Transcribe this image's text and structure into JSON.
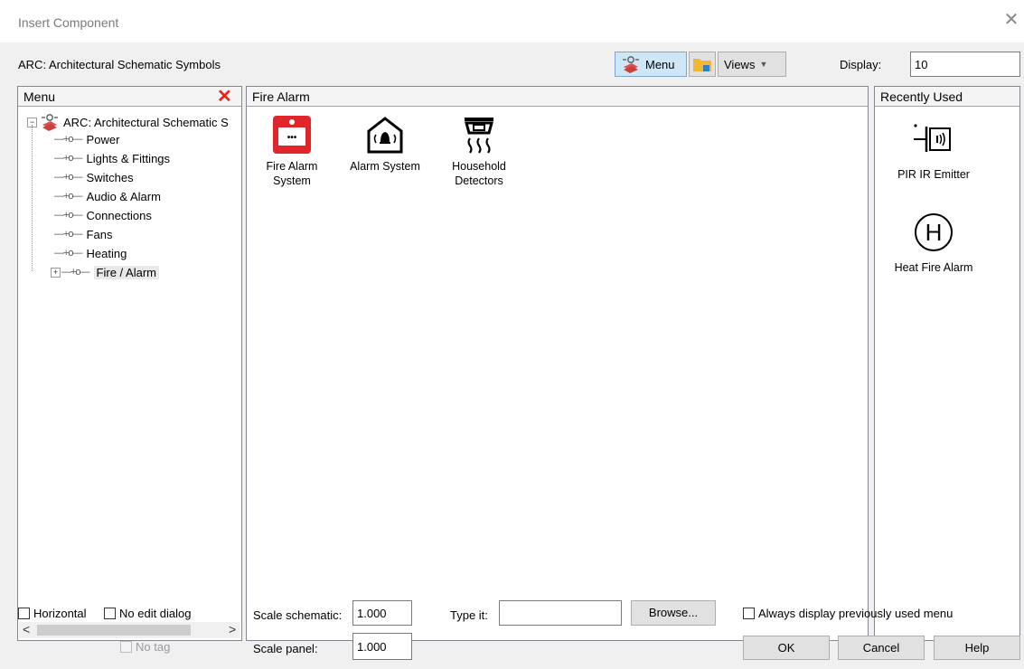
{
  "window": {
    "title": "Insert Component",
    "close_glyph": "✕"
  },
  "toolbar": {
    "library_name": "ARC: Architectural Schematic Symbols",
    "menu_button": "Menu",
    "views_button": "Views",
    "views_arrow": "▼",
    "display_label": "Display:",
    "display_value": "10"
  },
  "menu_panel": {
    "header": "Menu",
    "close_glyph": "✕",
    "root": "ARC: Architectural Schematic S",
    "items": [
      "Power",
      "Lights & Fittings",
      "Switches",
      "Audio & Alarm",
      "Connections",
      "Fans",
      "Heating",
      "Fire / Alarm"
    ],
    "selected_index": 7,
    "leaf_mark": "—+o—",
    "scroll_left": "<",
    "scroll_right": ">"
  },
  "content_panel": {
    "header": "Fire Alarm",
    "items": [
      {
        "label": "Fire Alarm System",
        "icon": "fire-alarm-system-icon"
      },
      {
        "label": "Alarm System",
        "icon": "alarm-system-icon"
      },
      {
        "label": "Household Detectors",
        "icon": "household-detectors-icon"
      }
    ]
  },
  "recent_panel": {
    "header": "Recently Used",
    "items": [
      {
        "label": "PIR IR Emitter",
        "icon": "pir-ir-emitter-icon"
      },
      {
        "label": "Heat Fire Alarm",
        "icon": "heat-fire-alarm-icon",
        "glyph": "H"
      }
    ]
  },
  "options": {
    "horizontal": "Horizontal",
    "no_edit_dialog": "No edit dialog",
    "no_tag": "No tag",
    "scale_schematic_label": "Scale schematic:",
    "scale_schematic_value": "1.000",
    "scale_panel_label": "Scale panel:",
    "scale_panel_value": "1.000",
    "type_it_label": "Type it:",
    "type_it_value": "",
    "browse_button": "Browse...",
    "always_display": "Always display previously used menu"
  },
  "buttons": {
    "ok": "OK",
    "cancel": "Cancel",
    "help": "Help"
  },
  "colors": {
    "close_red": "#e8231c",
    "fire_red": "#e0262b",
    "menu_active": "#cfe6f7",
    "folder_yellow": "#f2b632"
  }
}
